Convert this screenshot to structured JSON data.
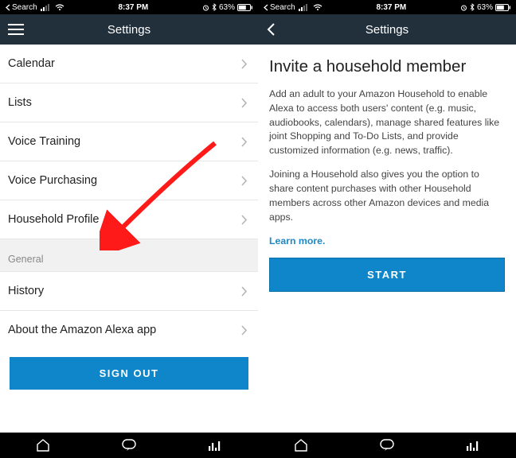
{
  "status": {
    "carrier_back": "Search",
    "time": "8:37 PM",
    "battery": "63%"
  },
  "left": {
    "header_title": "Settings",
    "items": [
      {
        "label": "Calendar"
      },
      {
        "label": "Lists"
      },
      {
        "label": "Voice Training"
      },
      {
        "label": "Voice Purchasing"
      },
      {
        "label": "Household Profile"
      }
    ],
    "section": "General",
    "general_items": [
      {
        "label": "History"
      },
      {
        "label": "About the Amazon Alexa app"
      }
    ],
    "signout": "SIGN OUT"
  },
  "right": {
    "header_title": "Settings",
    "title": "Invite a household member",
    "para1": "Add an adult to your Amazon Household to enable Alexa to access both users' content (e.g. music, audiobooks, calendars), manage shared features like joint Shopping and To-Do Lists, and provide customized information (e.g. news, traffic).",
    "para2": "Joining a Household also gives you the option to share content purchases with other Household members across other Amazon devices and media apps.",
    "learn_more": "Learn more.",
    "start": "START"
  }
}
